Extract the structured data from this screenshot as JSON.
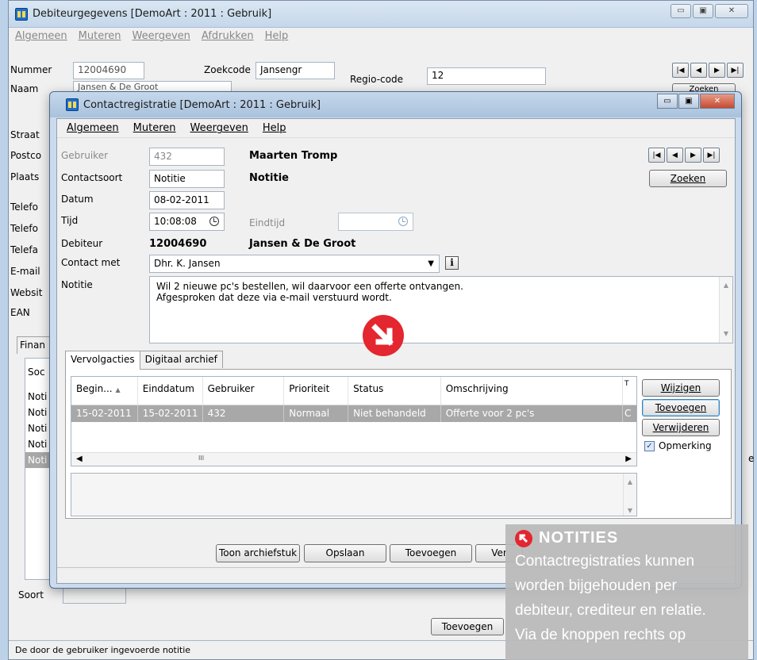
{
  "back_window": {
    "title": "Debiteurgegevens  [DemoArt : 2011 : Gebruik]",
    "menu": [
      "Algemeen",
      "Muteren",
      "Weergeven",
      "Afdrukken",
      "Help"
    ],
    "labels": {
      "nummer": "Nummer",
      "naam": "Naam",
      "straat": "Straat",
      "postcode": "Postco",
      "plaats": "Plaats",
      "telefoon1": "Telefo",
      "telefoon2": "Telefo",
      "telefax": "Telefa",
      "email": "E-mail",
      "website": "Websit",
      "ean": "EAN",
      "zoekcode": "Zoekcode",
      "regio_code": "Regio-code",
      "finan_tab": "Finan",
      "soort_col": "Soc",
      "soort": "Soort"
    },
    "values": {
      "nummer": "12004690",
      "naam": "Jansen & De Groot",
      "zoekcode": "Jansengr",
      "regio_code": "12"
    },
    "partial_zoeken": "Zoeken",
    "list_items": [
      "Noti",
      "Noti",
      "Noti",
      "Noti",
      "Noti"
    ],
    "toevoegen_button": "Toevoegen",
    "side_fragment": "e",
    "status_text": "De door de gebruiker ingevoerde notitie"
  },
  "front_window": {
    "title": "Contactregistratie  [DemoArt : 2011 : Gebruik]",
    "menu": [
      "Algemeen",
      "Muteren",
      "Weergeven",
      "Help"
    ],
    "fields": {
      "gebruiker_label": "Gebruiker",
      "gebruiker_value": "432",
      "gebruiker_name": "Maarten Tromp",
      "contactsoort_label": "Contactsoort",
      "contactsoort_value": "Notitie",
      "contactsoort_name": "Notitie",
      "datum_label": "Datum",
      "datum_value": "08-02-2011",
      "tijd_label": "Tijd",
      "tijd_value": "10:08:08",
      "eindtijd_label": "Eindtijd",
      "eindtijd_value": "",
      "debiteur_label": "Debiteur",
      "debiteur_number": "12004690",
      "debiteur_name": "Jansen & De Groot",
      "contact_met_label": "Contact met",
      "contact_met_value": "Dhr. K. Jansen",
      "notitie_label": "Notitie",
      "notitie_line1": "Wil 2 nieuwe pc's bestellen, wil daarvoor een offerte ontvangen.",
      "notitie_line2": "Afgesproken dat deze via e-mail verstuurd wordt."
    },
    "zoeken_button": "Zoeken",
    "tabs": [
      "Vervolgacties",
      "Digitaal archief"
    ],
    "grid": {
      "columns": [
        "Begin...",
        "Einddatum",
        "Gebruiker",
        "Prioriteit",
        "Status",
        "Omschrijving",
        "T"
      ],
      "rows": [
        [
          "15-02-2011",
          "15-02-2011",
          "432",
          "Normaal",
          "Niet behandeld",
          "Offerte voor 2 pc's",
          "C"
        ]
      ],
      "hscroll_thumb": "III"
    },
    "side_buttons": {
      "wijzigen": "Wijzigen",
      "toevoegen": "Toevoegen",
      "verwijderen": "Verwijderen"
    },
    "opmerking_label": "Opmerking",
    "opmerking_checked": true,
    "bottom_buttons": {
      "toon_archiefstuk": "Toon archiefstuk",
      "opslaan": "Opslaan",
      "toevoegen": "Toevoegen",
      "verwijderen_partial": "Ver"
    }
  },
  "callout": {
    "title": "NOTITIES",
    "lines": [
      "Contactregistraties kunnen",
      "worden bijgehouden per",
      "debiteur, crediteur en relatie.",
      "Via de knoppen rechts op"
    ]
  },
  "colors": {
    "accent_red": "#e3262f",
    "selected_row": "#a8a8a8",
    "window_frame": "#cbdbed"
  }
}
